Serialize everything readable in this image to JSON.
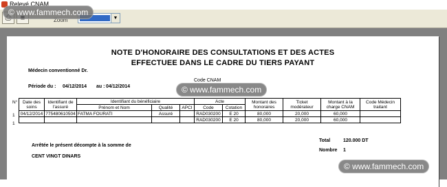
{
  "window": {
    "title": "Relevé CNAM"
  },
  "toolbar": {
    "zoom_label": "Zoom"
  },
  "report": {
    "title_line1": "NOTE D'HONORAIRE DES CONSULTATIONS ET DES ACTES",
    "title_line2": "EFFECTUEE DANS LE CADRE DU TIERS PAYANT",
    "code_cnam_label": "Code CNAM",
    "medecin_label": "Médecin conventionné Dr.",
    "periode_label": "Période du :",
    "periode_from": "04/12/2014",
    "periode_to_label": "au :",
    "periode_to": "04/12/2014",
    "col_no": "N°",
    "headers": {
      "date": "Date des soins",
      "identifiant_assure": "Identifiant de l'assuré",
      "identifiant_beneficiaire": "Identifiant du bénéficiaire",
      "prenom_nom": "Prénom et Nom",
      "qualite": "Qualité",
      "apci": "APCI",
      "acte": "Acte",
      "code": "Code",
      "cotation": "Cotation",
      "montant_honoraires": "Montant des honoraires",
      "ticket": "Ticket modérateur",
      "montant_cnam": "Montant à la charge CNAM",
      "code_medecin": "Code Médecin traitant"
    },
    "rows": [
      {
        "no": "1",
        "date": "04/12/2014",
        "assure": "775480610504",
        "nom": "FATMA FOURATI",
        "qualite": "Assuré",
        "apci": "",
        "code": "RAD030200",
        "cotation": "E 20",
        "honoraires": "80,000",
        "ticket": "20,000",
        "cnam": "60,000",
        "medecin": ""
      },
      {
        "no": "1",
        "date": "",
        "assure": "",
        "nom": "",
        "qualite": "",
        "apci": "",
        "code": "RAD030200",
        "cotation": "E 20",
        "honoraires": "80,000",
        "ticket": "20,000",
        "cnam": "60,000",
        "medecin": ""
      }
    ],
    "arrete_text": "Arrêtée le présent décompte à la somme de",
    "amount_words": "CENT VINGT DINARS",
    "total_label": "Total",
    "total_value": "120.000 DT",
    "nombre_label": "Nombre",
    "nombre_value": "1"
  },
  "watermark": {
    "text": "© www.fammech.com"
  }
}
